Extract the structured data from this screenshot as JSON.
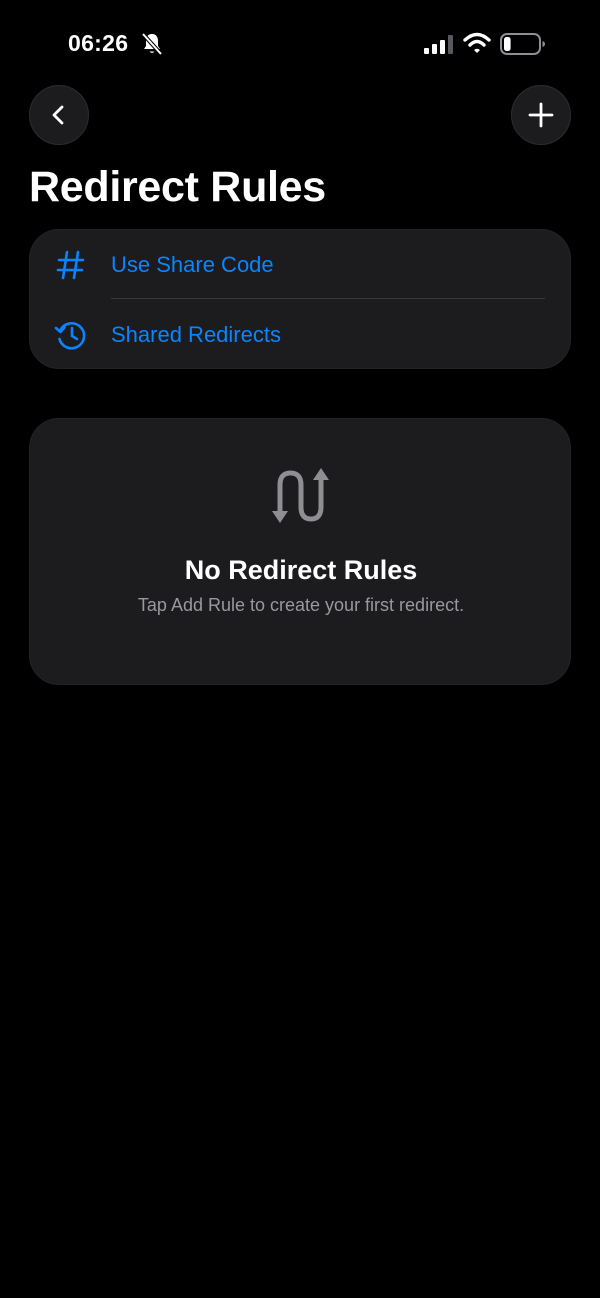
{
  "status_bar": {
    "time": "06:26",
    "icons": [
      "bell-slash-icon",
      "cellular-signal-icon",
      "wifi-icon",
      "battery-icon"
    ],
    "battery_level": 0.2
  },
  "nav": {
    "back_icon": "chevron-left-icon",
    "add_icon": "plus-icon"
  },
  "page": {
    "title": "Redirect Rules"
  },
  "menu": {
    "items": [
      {
        "label": "Use Share Code",
        "icon": "hashtag-icon"
      },
      {
        "label": "Shared Redirects",
        "icon": "clock-history-icon"
      }
    ]
  },
  "empty_state": {
    "icon": "redirect-arrows-icon",
    "title": "No Redirect Rules",
    "subtitle": "Tap Add Rule to create your first redirect."
  },
  "colors": {
    "background": "#000000",
    "card": "#1c1c1e",
    "accent": "#0a84ff",
    "secondary_text": "#98989f",
    "icon_gray": "#8e8e93"
  }
}
